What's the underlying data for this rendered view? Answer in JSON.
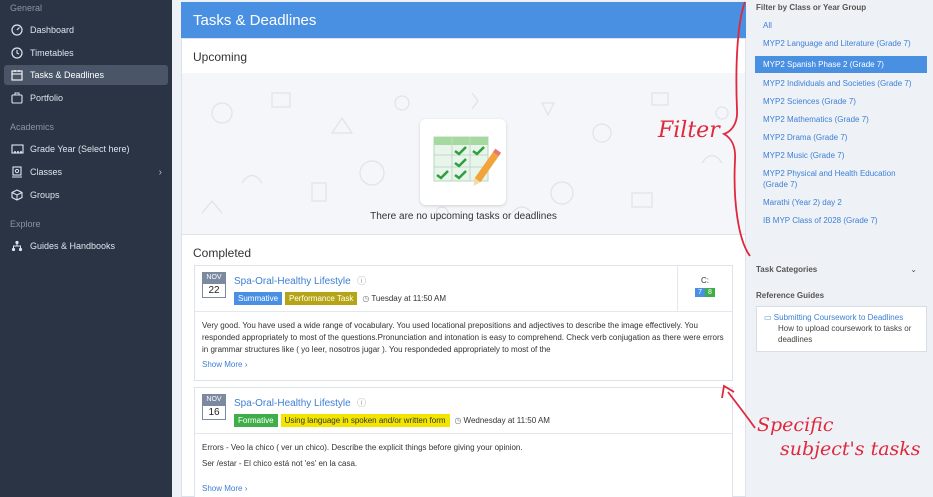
{
  "sidebar": {
    "general_label": "General",
    "academics_label": "Academics",
    "explore_label": "Explore",
    "items": [
      {
        "label": "Dashboard"
      },
      {
        "label": "Timetables"
      },
      {
        "label": "Tasks & Deadlines"
      },
      {
        "label": "Portfolio"
      },
      {
        "label": "Grade Year (Select here)"
      },
      {
        "label": "Classes"
      },
      {
        "label": "Groups"
      },
      {
        "label": "Guides & Handbooks"
      }
    ]
  },
  "page": {
    "title": "Tasks & Deadlines",
    "upcoming_heading": "Upcoming",
    "empty_message": "There are no upcoming tasks or deadlines",
    "completed_heading": "Completed"
  },
  "tasks": [
    {
      "month": "NOV",
      "day": "22",
      "name": "Spa-Oral-Healthy Lifestyle",
      "type": "Summative",
      "category": "Performance Task",
      "due": "Tuesday at 11:50 AM",
      "grade_label": "C:",
      "grade_values": [
        "7",
        "8"
      ],
      "feedback": "Very good. You have used a wide range of vocabulary. You used locational prepositions and adjectives to describe the image effectively. You responded appropriately to most of the questions.Pronunciation and intonation is easy to comprehend.  Check verb conjugation as there were errors in grammar structures like ( yo leer, nosotros jugar ).  You respondeded appropriately to most of the",
      "show_more": "Show More"
    },
    {
      "month": "NOV",
      "day": "16",
      "name": "Spa-Oral-Healthy Lifestyle",
      "type": "Formative",
      "category": "Using language in spoken and/or written form",
      "due": "Wednesday at 11:50 AM",
      "feedback_line1": "Errors - Veo la chico ( ver un chico). Describe the explicit things before giving your opinion.",
      "feedback_line2": "Ser /estar - El chico está not 'es' en la casa.",
      "show_more": "Show More"
    }
  ],
  "filter": {
    "heading": "Filter by Class or Year Group",
    "items": [
      "All",
      "MYP2 Language and Literature (Grade 7)",
      "MYP2 Spanish Phase 2 (Grade 7)",
      "MYP2 Individuals and Societies (Grade 7)",
      "MYP2 Sciences (Grade 7)",
      "MYP2 Mathematics (Grade 7)",
      "MYP2 Drama (Grade 7)",
      "MYP2 Music (Grade 7)",
      "MYP2 Physical and Health Education (Grade 7)",
      "Marathi (Year 2) day 2",
      "IB MYP Class of 2028 (Grade 7)"
    ],
    "selected": "MYP2 Spanish Phase 2 (Grade 7)"
  },
  "task_categories_label": "Task Categories",
  "reference": {
    "heading": "Reference Guides",
    "link": "Submitting Coursework to Deadlines",
    "desc": "How to upload coursework to tasks or deadlines"
  },
  "annotations": {
    "filter": "Filter",
    "specific_line1": "Specific",
    "specific_line2": "subject's tasks"
  },
  "colors": {
    "summative": "#4a90e2",
    "performance": "#b5a516",
    "formative": "#3fae49",
    "language_tag": "#f2e600",
    "annotation": "#e0283c"
  }
}
